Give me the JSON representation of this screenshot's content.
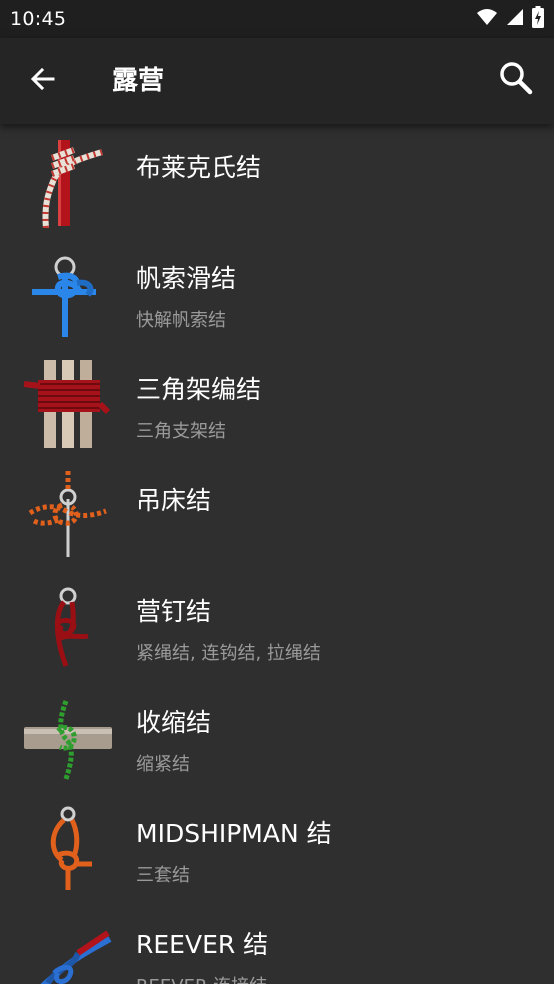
{
  "status_bar": {
    "time": "10:45",
    "icons": [
      "wifi-icon",
      "signal-icon",
      "battery-charging-icon"
    ]
  },
  "app_bar": {
    "back_icon": "arrow-back-icon",
    "title": "露营",
    "search_icon": "search-icon"
  },
  "list": {
    "items": [
      {
        "title": "布莱克氏结",
        "subtitle": "",
        "icon": "blakes-hitch-knot-icon"
      },
      {
        "title": "帆索滑结",
        "subtitle": "快解帆索结",
        "icon": "slipped-buntline-knot-icon"
      },
      {
        "title": "三角架编结",
        "subtitle": "三角支架结",
        "icon": "tripod-lashing-knot-icon"
      },
      {
        "title": "吊床结",
        "subtitle": "",
        "icon": "hammock-hitch-knot-icon"
      },
      {
        "title": "营钉结",
        "subtitle": "紧绳结, 连钩结, 拉绳结",
        "icon": "tent-peg-knot-icon"
      },
      {
        "title": "收缩结",
        "subtitle": "缩紧结",
        "icon": "constrictor-knot-icon"
      },
      {
        "title": "MIDSHIPMAN 结",
        "subtitle": "三套结",
        "icon": "midshipman-knot-icon"
      },
      {
        "title": "REEVER 结",
        "subtitle": "REEVER 连接结",
        "icon": "reever-knot-icon"
      }
    ]
  },
  "colors": {
    "background": "#2f2f2f",
    "app_bar": "#252525",
    "status_bar": "#1f1f1f",
    "subtitle": "#9a9a9a",
    "rope_red": "#b3141b",
    "rope_blue": "#2a86e8",
    "rope_orange": "#e0601c",
    "rope_green": "#2e9e2e"
  }
}
